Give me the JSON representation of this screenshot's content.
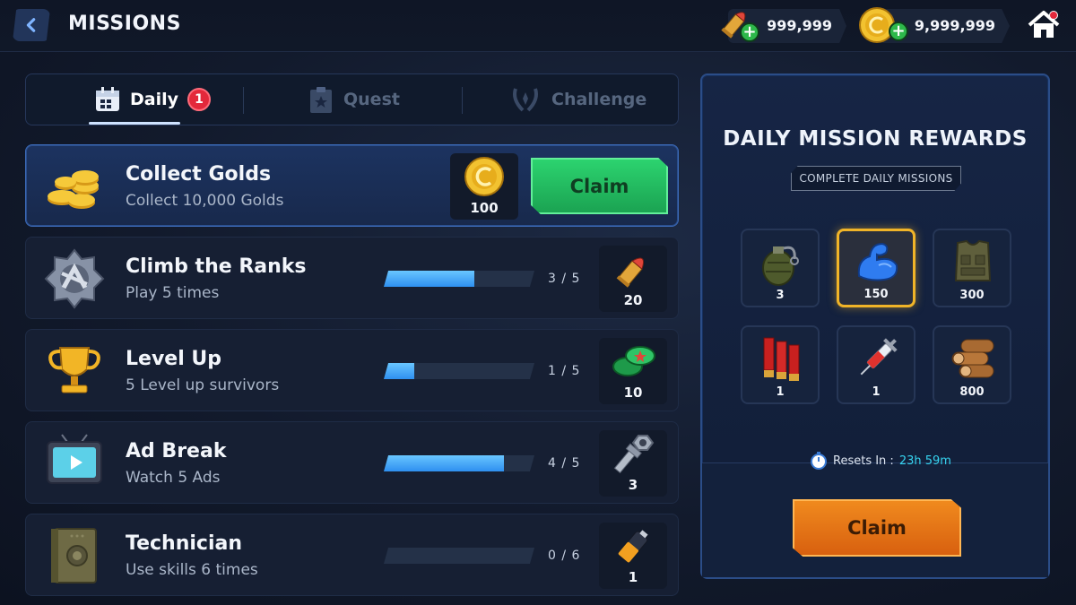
{
  "header": {
    "title": "MISSIONS",
    "ammo_amount": "999,999",
    "gold_amount": "9,999,999"
  },
  "tabs": [
    {
      "label": "Daily",
      "badge": "1",
      "active": true
    },
    {
      "label": "Quest",
      "active": false
    },
    {
      "label": "Challenge",
      "active": false
    }
  ],
  "missions": [
    {
      "title": "Collect Golds",
      "desc": "Collect 10,000 Golds",
      "reward_icon": "gold-coin-icon",
      "reward_qty": "100",
      "claim_label": "Claim",
      "state": "claimable"
    },
    {
      "title": "Climb the Ranks",
      "desc": "Play 5 times",
      "progress": 0.6,
      "progress_text": "3 / 5",
      "reward_icon": "bullet-icon",
      "reward_qty": "20"
    },
    {
      "title": "Level Up",
      "desc": "5 Level up survivors",
      "progress": 0.2,
      "progress_text": "1 / 5",
      "reward_icon": "bottle-cap-icon",
      "reward_qty": "10"
    },
    {
      "title": "Ad Break",
      "desc": "Watch 5 Ads",
      "progress": 0.8,
      "progress_text": "4 / 5",
      "reward_icon": "bolt-nut-icon",
      "reward_qty": "3"
    },
    {
      "title": "Technician",
      "desc": "Use skills 6 times",
      "progress": 0.0,
      "progress_text": "0 / 6",
      "reward_icon": "battery-icon",
      "reward_qty": "1"
    }
  ],
  "rewards_panel": {
    "title": "DAILY MISSION REWARDS",
    "subtitle": "COMPLETE DAILY MISSIONS",
    "items": [
      {
        "icon": "grenade-icon",
        "qty": "3"
      },
      {
        "icon": "muscle-arm-icon",
        "qty": "150",
        "highlighted": true
      },
      {
        "icon": "armor-vest-icon",
        "qty": "300"
      },
      {
        "icon": "shotgun-shells-icon",
        "qty": "1"
      },
      {
        "icon": "syringe-icon",
        "qty": "1"
      },
      {
        "icon": "wood-logs-icon",
        "qty": "800"
      }
    ],
    "reset_label": "Resets In :",
    "reset_time": "23h 59m",
    "claim_label": "Claim"
  },
  "colors": {
    "claim_green": "#2cd36f",
    "claim_orange": "#f08a1e",
    "progress_blue": "#3fa6f7",
    "badge_red": "#e3283b",
    "highlight_gold": "#f0b428"
  }
}
